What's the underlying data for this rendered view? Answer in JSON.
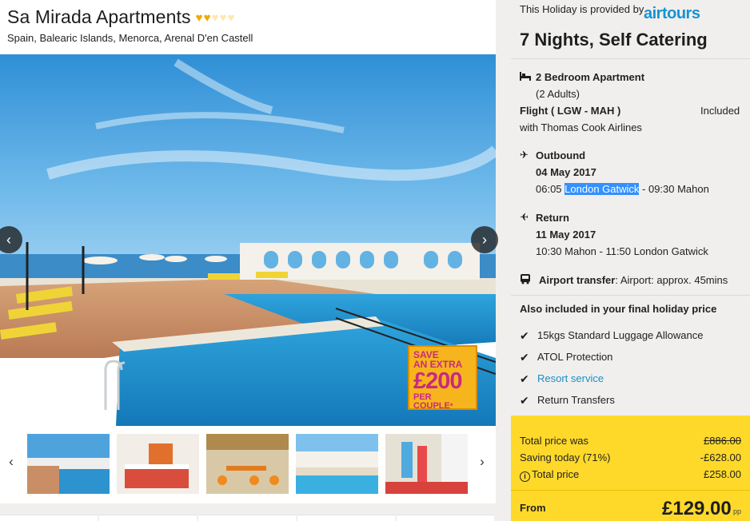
{
  "hotel": {
    "name": "Sa Mirada Apartments",
    "rating_hearts": 2,
    "rating_max": 5,
    "location": "Spain, Balearic Islands, Menorca, Arenal D'en Castell"
  },
  "gallery": {
    "prev_icon": "chevron-left-icon",
    "next_icon": "chevron-right-icon",
    "promo": {
      "line1": "SAVE",
      "line2": "AN EXTRA",
      "amount": "£200",
      "line3": "PER COUPLE",
      "mark": "*"
    },
    "thumbnails": [
      "pool-view",
      "bedroom",
      "restaurant",
      "pool-exterior",
      "playground"
    ]
  },
  "summary": {
    "provided_by_label": "This Holiday is provided by",
    "provider": "airtours",
    "duration": "7 Nights, Self Catering",
    "room_type": "2 Bedroom Apartment",
    "guests": "(2 Adults)",
    "flight_label": "Flight ( LGW - MAH )",
    "flight_status": "Included",
    "airline": "with Thomas Cook Airlines",
    "outbound": {
      "label": "Outbound",
      "date": "04 May 2017",
      "dep_time": "06:05",
      "dep_airport": "London Gatwick",
      "rest": " - 09:30 Mahon"
    },
    "return": {
      "label": "Return",
      "date": "11 May 2017",
      "details": "10:30 Mahon - 11:50 London Gatwick"
    },
    "transfer_label": "Airport transfer",
    "transfer_detail": ": Airport: approx. 45mins",
    "also_included_title": "Also included in your final holiday price",
    "included_items": [
      {
        "text": "15kgs Standard Luggage Allowance",
        "link": false
      },
      {
        "text": "ATOL Protection",
        "link": false
      },
      {
        "text": "Resort service",
        "link": true
      },
      {
        "text": "Return Transfers",
        "link": false
      }
    ]
  },
  "pricing": {
    "total_was_label": "Total price was",
    "total_was": "£886.00",
    "saving_label": "Saving today (71%)",
    "saving": "-£628.00",
    "total_label": "Total price",
    "total": "£258.00",
    "from_label": "From",
    "pp_price": "£129.00",
    "pp_label": "pp"
  },
  "colors": {
    "heart_on": "#f2a900",
    "heart_off": "#fde9b0",
    "brand_blue": "#1792d4",
    "price_box": "#ffd92a",
    "link": "#1a8fc9",
    "promo_bg": "#f6b51c",
    "promo_text": "#c82a7f"
  }
}
